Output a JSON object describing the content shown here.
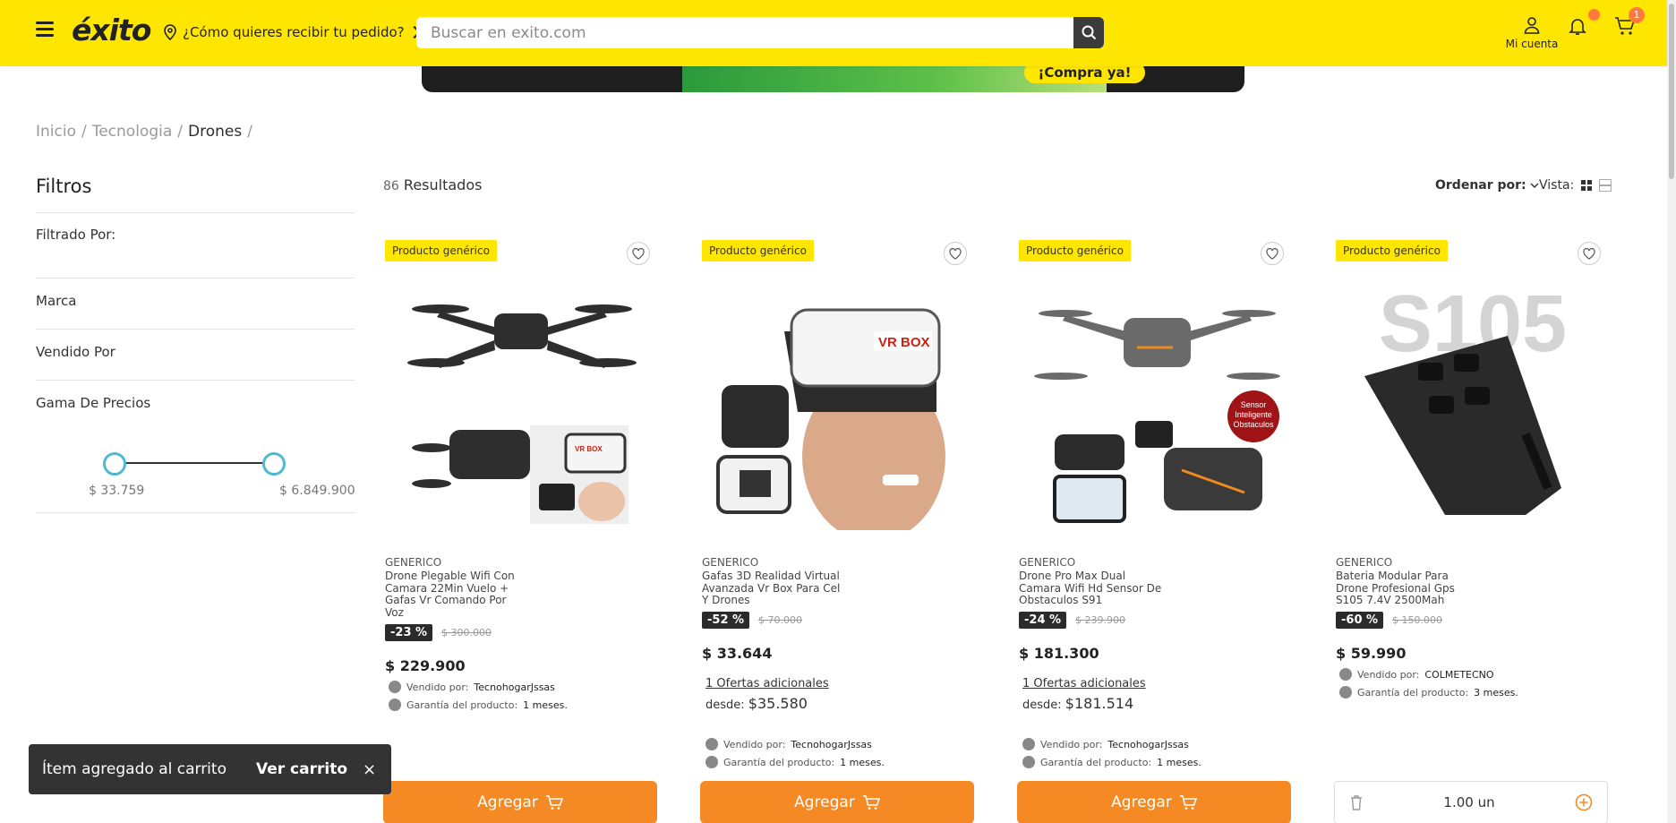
{
  "header": {
    "logo": "éxito",
    "delivery_prompt": "¿Cómo quieres recibir tu pedido?",
    "search_placeholder": "Buscar en exito.com",
    "account_label": "Mi cuenta",
    "cart_count": "1"
  },
  "banner": {
    "cta": "¡Compra ya!"
  },
  "breadcrumb": [
    {
      "label": "Inicio"
    },
    {
      "label": "Tecnologia"
    },
    {
      "label": "Drones"
    }
  ],
  "filters": {
    "title": "Filtros",
    "filtered_by": "Filtrado Por:",
    "brand": "Marca",
    "sold_by": "Vendido Por",
    "price_range": "Gama De Precios",
    "price_min": "$ 33.759",
    "price_max": "$ 6.849.900"
  },
  "results": {
    "count": "86",
    "label": "Resultados",
    "sort_label": "Ordenar por:",
    "view_label": "Vista:"
  },
  "products": [
    {
      "badge": "Producto genérico",
      "brand": "GENERICO",
      "name": "Drone Plegable Wifi Con Camara 22Min Vuelo + Gafas Vr Comando Por Voz",
      "discount": "-23 %",
      "old_price": "$ 300.000",
      "price": "$ 229.900",
      "sold_by_label": "Vendido por:",
      "seller": "TecnohogarJssas",
      "warranty_label": "Garantía del producto:",
      "warranty": "1 meses.",
      "button": "Agregar"
    },
    {
      "badge": "Producto genérico",
      "brand": "GENERICO",
      "name": "Gafas 3D Realidad Virtual Avanzada Vr Box Para Cel Y Drones",
      "discount": "-52 %",
      "old_price": "$ 70.000",
      "price": "$ 33.644",
      "offers": "1 Ofertas adicionales",
      "desde_label": "desde:",
      "desde_price": "$35.580",
      "sold_by_label": "Vendido por:",
      "seller": "TecnohogarJssas",
      "warranty_label": "Garantía del producto:",
      "warranty": "1 meses.",
      "button": "Agregar"
    },
    {
      "badge": "Producto genérico",
      "brand": "GENERICO",
      "name": "Drone Pro Max Dual Camara Wifi Hd Sensor De Obstaculos S91",
      "discount": "-24 %",
      "old_price": "$ 239.900",
      "price": "$ 181.300",
      "offers": "1 Ofertas adicionales",
      "desde_label": "desde:",
      "desde_price": "$181.514",
      "image_tag": "Sensor Inteligente Obstaculos",
      "sold_by_label": "Vendido por:",
      "seller": "TecnohogarJssas",
      "warranty_label": "Garantía del producto:",
      "warranty": "1 meses.",
      "button": "Agregar"
    },
    {
      "badge": "Producto genérico",
      "brand": "GENERICO",
      "name": "Bateria Modular Para Drone Profesional Gps S105 7.4V 2500Mah",
      "discount": "-60 %",
      "old_price": "$ 150.000",
      "price": "$ 59.990",
      "image_text": "S105",
      "sold_by_label": "Vendido por:",
      "seller": "COLMETECNO",
      "warranty_label": "Garantía del producto:",
      "warranty": "3 meses.",
      "quantity": "1.00 un"
    }
  ],
  "toast": {
    "message": "Ítem agregado al carrito",
    "cta": "Ver carrito",
    "close": "×"
  },
  "colors": {
    "brand_yellow": "#ffe600",
    "button_orange": "#f58a24",
    "slider_accent": "#4fb9d1"
  }
}
